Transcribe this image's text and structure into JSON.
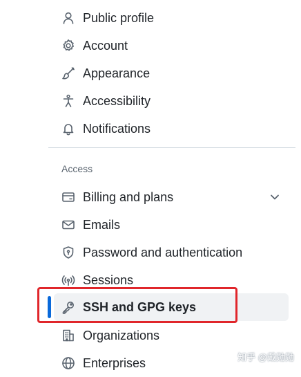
{
  "sections": [
    {
      "heading": "",
      "items": [
        {
          "label": "Public profile",
          "icon": "person-icon"
        },
        {
          "label": "Account",
          "icon": "gear-icon"
        },
        {
          "label": "Appearance",
          "icon": "paintbrush-icon"
        },
        {
          "label": "Accessibility",
          "icon": "accessibility-icon"
        },
        {
          "label": "Notifications",
          "icon": "bell-icon"
        }
      ]
    },
    {
      "heading": "Access",
      "items": [
        {
          "label": "Billing and plans",
          "icon": "credit-card-icon",
          "expandable": true
        },
        {
          "label": "Emails",
          "icon": "mail-icon"
        },
        {
          "label": "Password and authentication",
          "icon": "shield-lock-icon"
        },
        {
          "label": "Sessions",
          "icon": "broadcast-icon"
        },
        {
          "label": "SSH and GPG keys",
          "icon": "key-icon",
          "active": true
        },
        {
          "label": "Organizations",
          "icon": "organization-icon"
        },
        {
          "label": "Enterprises",
          "icon": "globe-icon"
        }
      ]
    }
  ],
  "colors": {
    "accent": "#0969da",
    "highlight_box": "#e0262b",
    "active_bg": "#f0f2f4"
  },
  "watermark": "知乎 @戴勋勋"
}
